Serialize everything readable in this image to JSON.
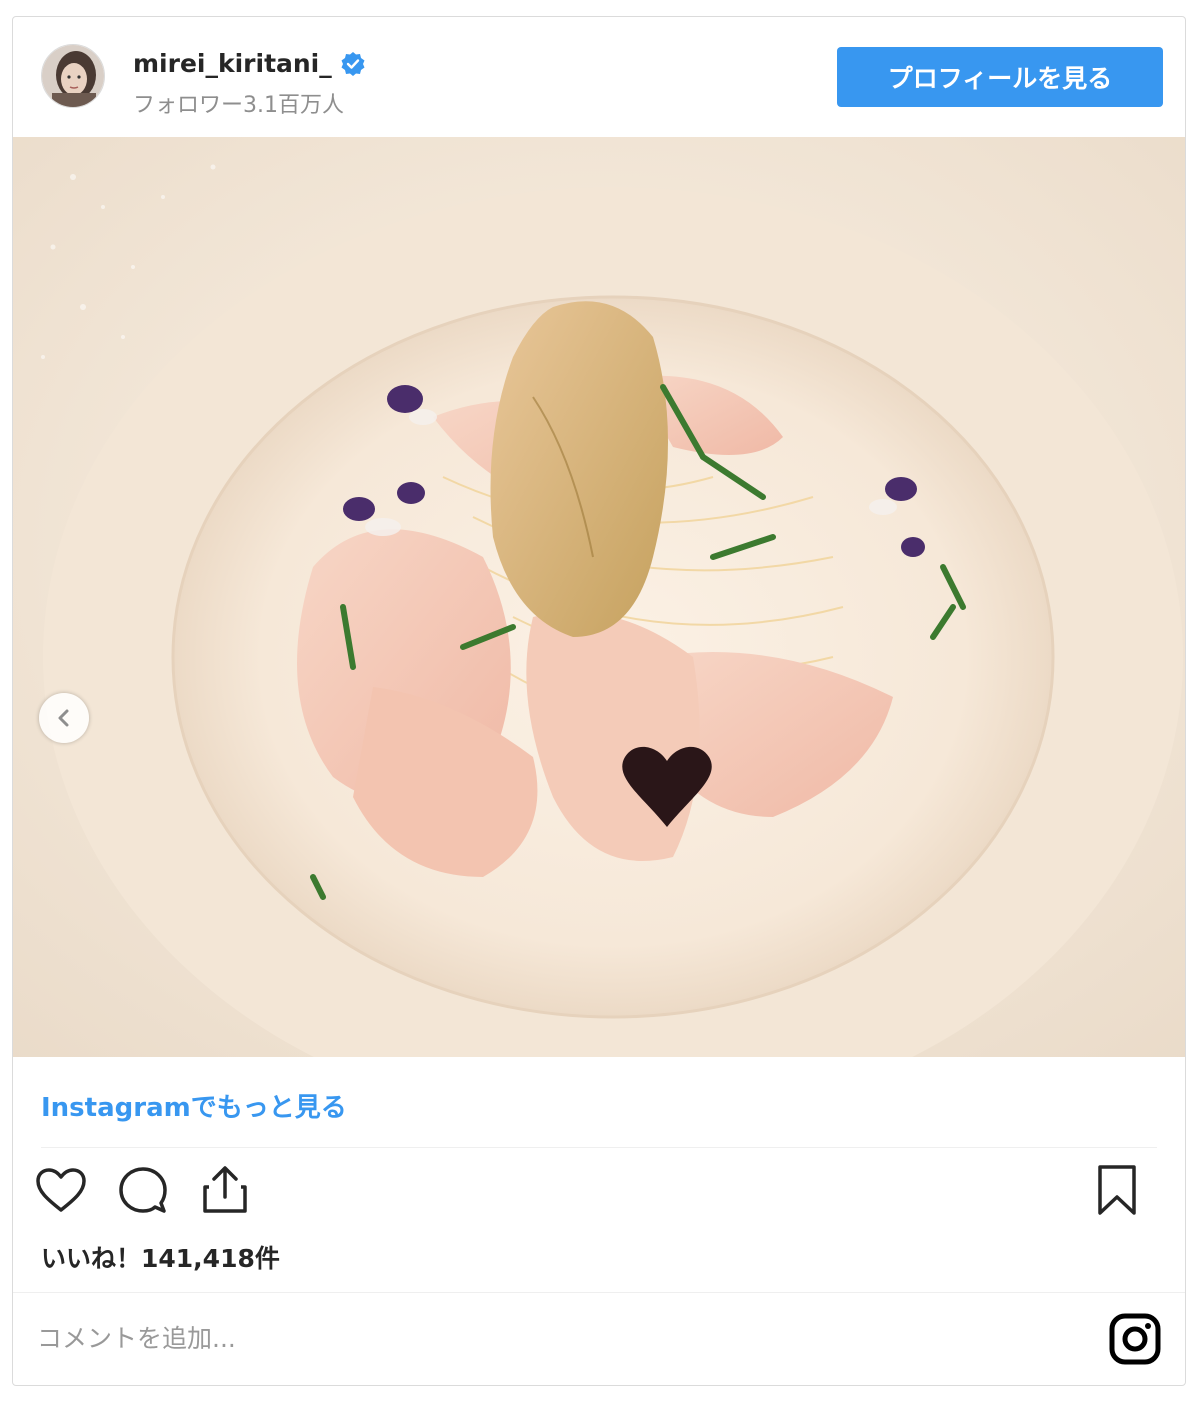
{
  "header": {
    "username": "mirei_kiritani_",
    "followers": "フォロワー3.1百万人",
    "profile_button": "プロフィールを見る"
  },
  "post": {
    "image_description": "",
    "more_link": "Instagramでもっと見る",
    "likes": "いいね！141,418件"
  },
  "comment": {
    "placeholder": "コメントを追加..."
  },
  "icons": {
    "verified": "verified-badge-icon",
    "prev": "chevron-left-icon",
    "like": "heart-icon",
    "comment": "comment-icon",
    "share": "share-icon",
    "save": "bookmark-icon",
    "instagram": "instagram-logo-icon"
  },
  "colors": {
    "accent": "#3897f0",
    "text": "#262626",
    "muted": "#8e8e8e"
  }
}
